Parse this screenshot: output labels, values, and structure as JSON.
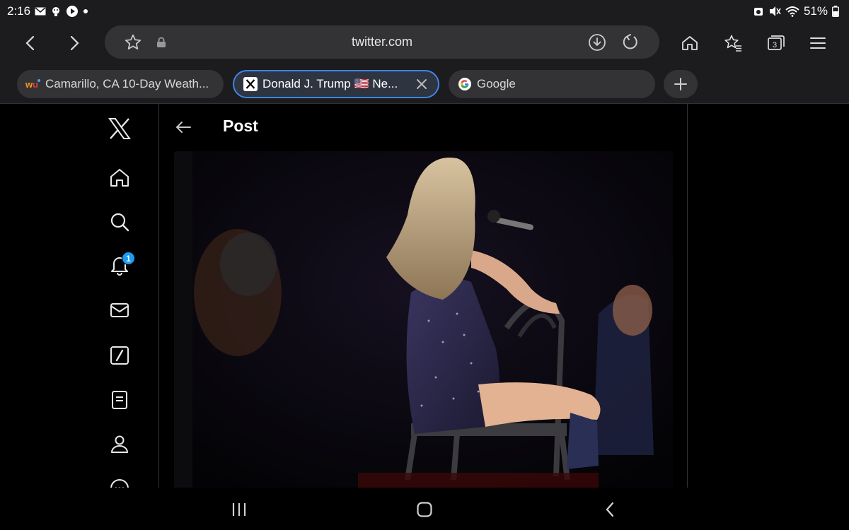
{
  "status_bar": {
    "time": "2:16",
    "battery": "51%",
    "left_icons": [
      "mail-icon",
      "assistant-icon",
      "play-icon",
      "dot-icon"
    ],
    "right_icons": [
      "alarm-icon",
      "mute-icon",
      "wifi-icon",
      "battery-icon"
    ]
  },
  "toolbar": {
    "url": "twitter.com",
    "tab_count": "3"
  },
  "tabs": [
    {
      "title": "Camarillo, CA 10-Day Weath...",
      "favicon": "wu-icon",
      "active": false
    },
    {
      "title": "Donald J. Trump 🇺🇸 Ne...",
      "favicon": "x-logo-icon",
      "active": true
    },
    {
      "title": "Google",
      "favicon": "google-icon",
      "active": false
    }
  ],
  "sidebar": {
    "notifications_badge": "1",
    "items": [
      "x-logo",
      "home",
      "explore",
      "notifications",
      "messages",
      "grok",
      "lists",
      "profile",
      "more"
    ]
  },
  "main": {
    "header_title": "Post"
  },
  "colors": {
    "accent": "#1d9bf0",
    "active_tab_border": "#3d86e8",
    "chrome_bg": "#1c1c1e"
  }
}
